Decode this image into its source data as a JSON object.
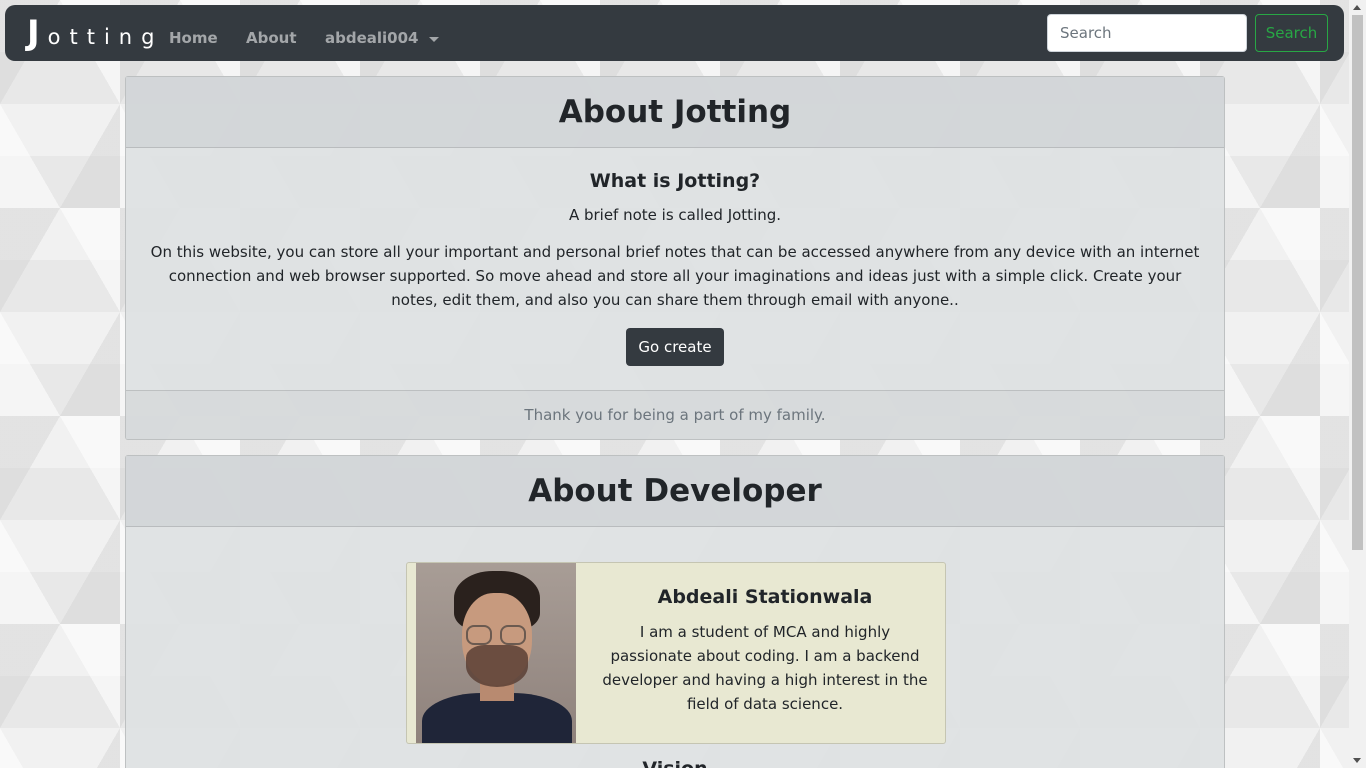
{
  "navbar": {
    "brand_initial": "J",
    "brand_rest": "otting",
    "links": {
      "home": "Home",
      "about": "About",
      "user": "abdeali004"
    },
    "search": {
      "placeholder": "Search",
      "button_label": "Search"
    }
  },
  "about_card": {
    "title": "About Jotting",
    "subtitle": "What is Jotting?",
    "lead": "A brief note is called Jotting.",
    "paragraph": "On this website, you can store all your important and personal brief notes that can be accessed anywhere from any device with an internet connection and web browser supported. So move ahead and store all your imaginations and ideas just with a simple click. Create your notes, edit them, and also you can share them through email with anyone..",
    "button_label": "Go create",
    "footer": "Thank you for being a part of my family."
  },
  "developer_card": {
    "title": "About Developer",
    "name": "Abdeali Stationwala",
    "bio": "I am a student of MCA and highly passionate about coding. I am a backend developer and having a high interest in the field of data science.",
    "next_heading": "Vision"
  },
  "colors": {
    "navbar": "#343a40",
    "success": "#28a745",
    "card_bg": "#dee2e3",
    "dev_card_bg": "#e8e8d2"
  }
}
